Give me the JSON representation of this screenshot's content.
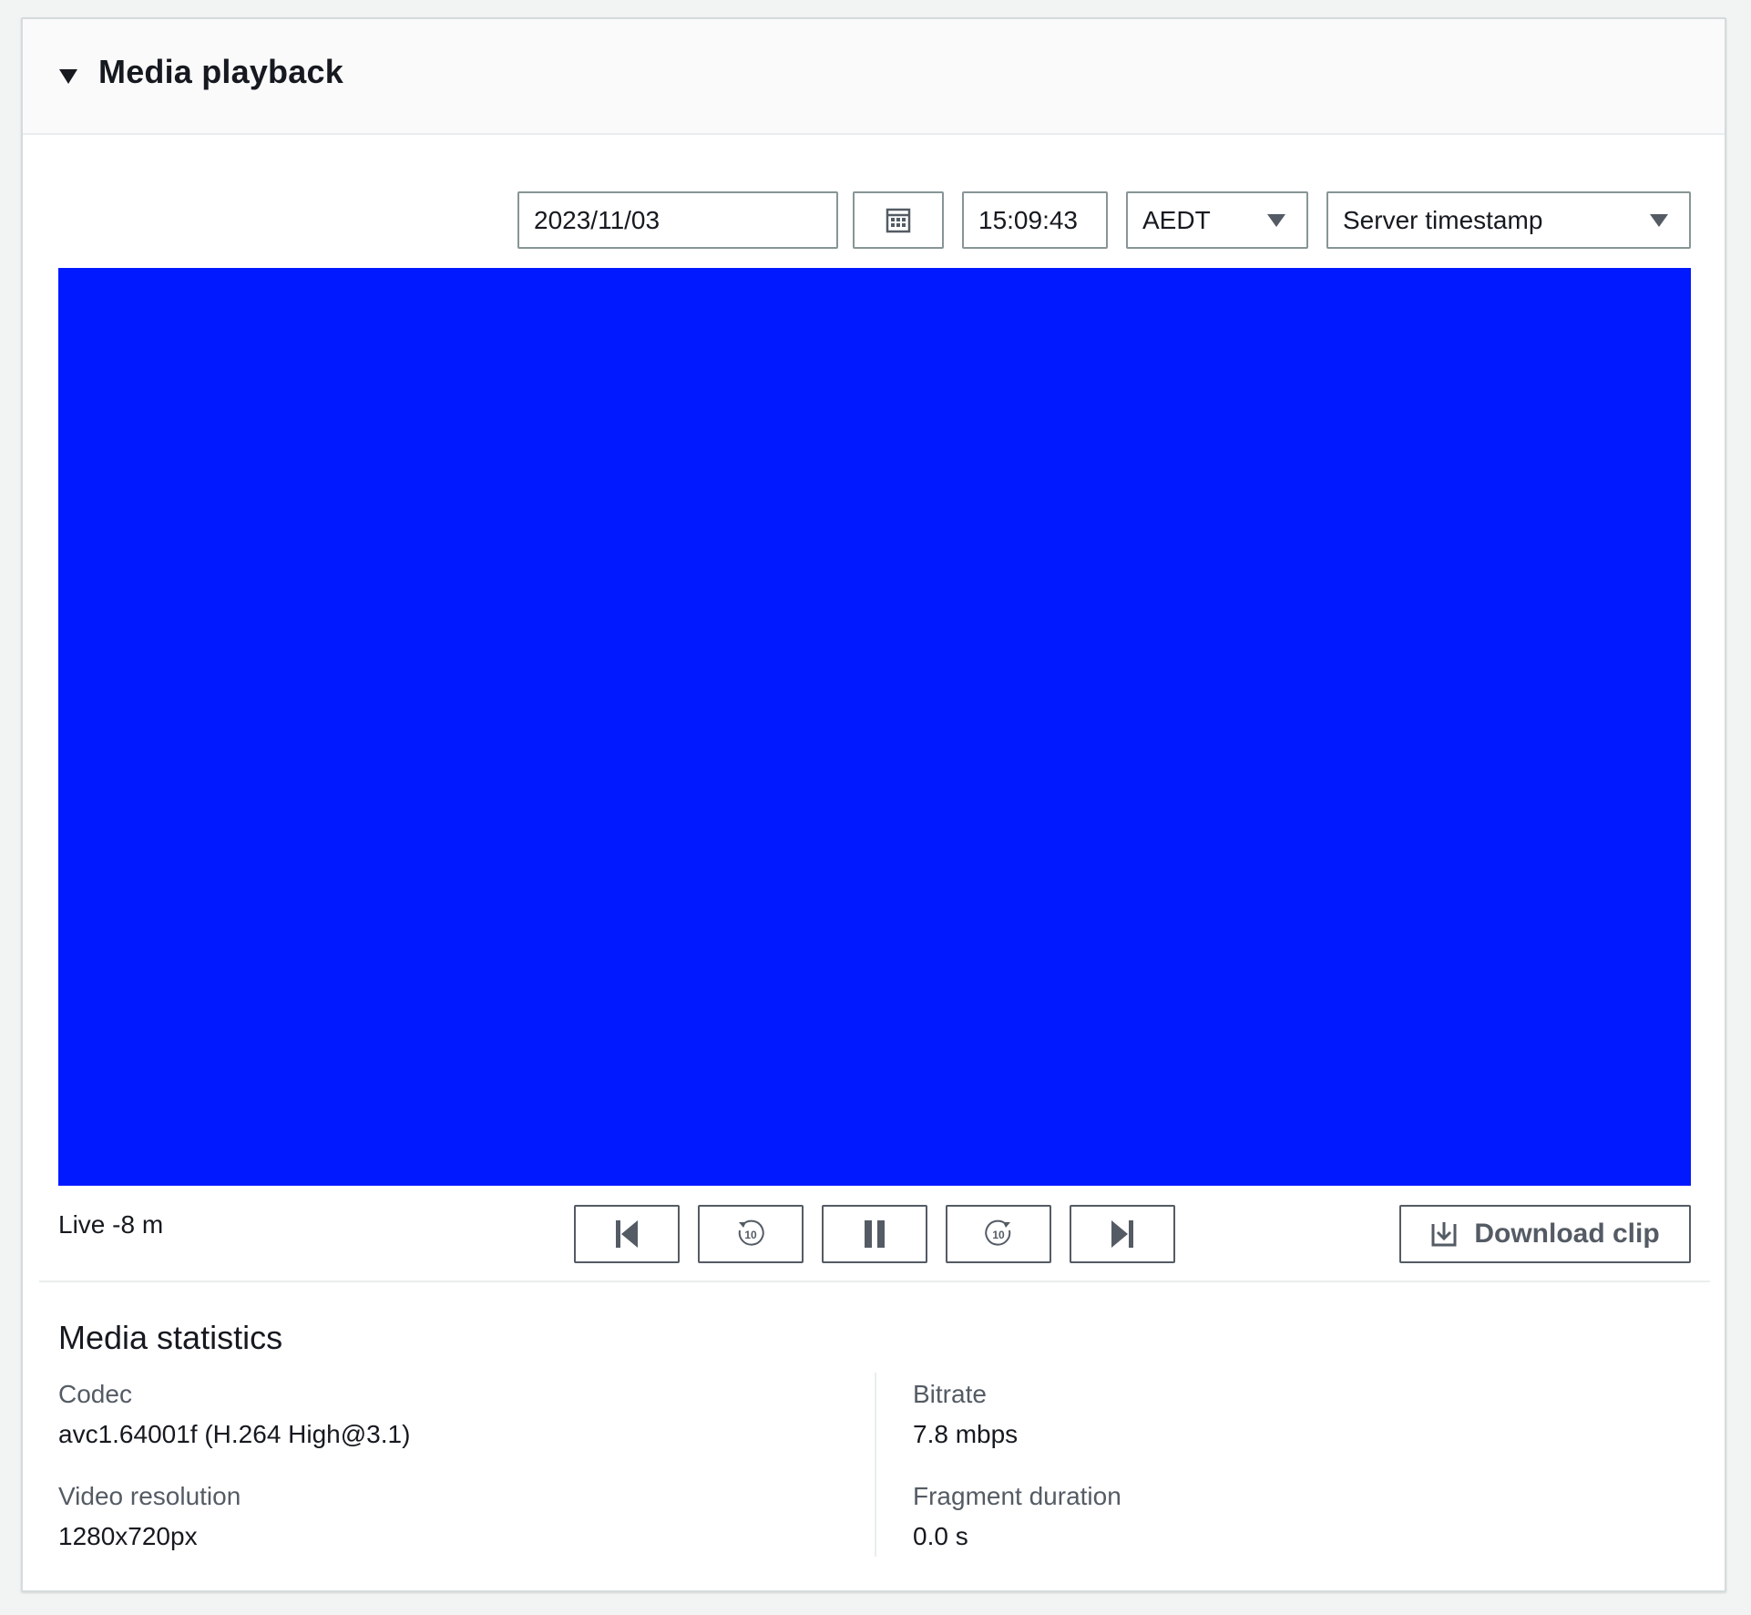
{
  "panel": {
    "title": "Media playback",
    "caret_icon": "caret-down-icon"
  },
  "controls": {
    "date_value": "2023/11/03",
    "calendar_icon": "calendar-icon",
    "time_value": "15:09:43",
    "timezone_selected": "AEDT",
    "timestamp_type_selected": "Server timestamp"
  },
  "video": {
    "background_color": "#0019ff"
  },
  "playback": {
    "live_offset": "Live -8 m",
    "buttons": [
      {
        "name": "skip-to-start-button",
        "icon": "skip-back-icon"
      },
      {
        "name": "rewind-10-button",
        "icon": "rewind-10-icon",
        "label": "10"
      },
      {
        "name": "pause-button",
        "icon": "pause-icon"
      },
      {
        "name": "forward-10-button",
        "icon": "forward-10-icon",
        "label": "10"
      },
      {
        "name": "skip-to-end-button",
        "icon": "skip-forward-icon"
      }
    ],
    "download_label": "Download clip",
    "download_icon": "download-icon"
  },
  "stats": {
    "title": "Media statistics",
    "codec_label": "Codec",
    "codec_value": "avc1.64001f (H.264 High@3.1)",
    "resolution_label": "Video resolution",
    "resolution_value": "1280x720px",
    "bitrate_label": "Bitrate",
    "bitrate_value": "7.8 mbps",
    "fragment_label": "Fragment duration",
    "fragment_value": "0.0 s"
  }
}
